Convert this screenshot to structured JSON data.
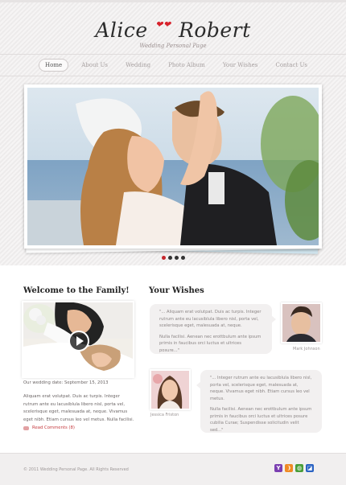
{
  "logo": {
    "name_left": "Alice",
    "name_right": "Robert",
    "hearts": "❤❤",
    "subtitle": "Wedding Personal Page"
  },
  "nav": {
    "items": [
      {
        "label": "Home",
        "active": true
      },
      {
        "label": "About Us",
        "active": false
      },
      {
        "label": "Wedding",
        "active": false
      },
      {
        "label": "Photo Album",
        "active": false
      },
      {
        "label": "Your Wishes",
        "active": false
      },
      {
        "label": "Contact Us",
        "active": false
      }
    ]
  },
  "slider": {
    "dots": 4,
    "active_dot": 0
  },
  "welcome": {
    "title": "Welcome to the Family!",
    "date_text": "Our wedding date: September 15, 2013",
    "body": "Aliquam erat volutpat. Duis ac turpis. Integer rutrum ante eu lacusiblula libero nisl, porta vel, scelerisque eget, malesuada at, neque. Vivamus eget nibh. Etiam cursus leo vel metus. Nulla facilisi.",
    "read_comments": "Read Comments (8)"
  },
  "wishes": {
    "title": "Your Wishes",
    "items": [
      {
        "paragraphs": [
          "\"... Aliquam erat volutpat. Duis ac turpis. Integer rutrum ante eu lacusiblula libero nisl, porta vel, scelerisque eget, malesuada at, neque.",
          "Nulla facilisi. Aenean nec erottbulum ante ipsum primis in faucibus orci luctus et ultrices posure...\""
        ],
        "author": "Mark Johnson"
      },
      {
        "paragraphs": [
          "\"... Integer rutrum ante eu lacusiblula libero nisl, porta vel, scelerisque eget, malesuada at, neque. Vivamus eget nibh. Etiam cursus leo vel metus.",
          "Nulla facilisi. Aenean nec erottbulum ante ipsum primis in faucibus orci luctus et ultrices posure cubilia Curae; Suspendisse solicitudin velit sed...\""
        ],
        "author": "Jessica Friston"
      }
    ]
  },
  "footer": {
    "copyright": "© 2011 Wedding Personal Page.  All Rights Reserved",
    "social": [
      {
        "icon": "yahoo-icon",
        "glyph": "Y",
        "color": "#7b3fb1"
      },
      {
        "icon": "rss-icon",
        "glyph": "❩",
        "color": "#f08a24"
      },
      {
        "icon": "myspace-icon",
        "glyph": "◍",
        "color": "#4a9e3a"
      },
      {
        "icon": "delicious-icon",
        "glyph": "◪",
        "color": "#2a63c3"
      }
    ]
  },
  "colors": {
    "accent": "#c5262b",
    "header_bg": "#f1efef",
    "bubble_bg": "#f2f0f0"
  }
}
